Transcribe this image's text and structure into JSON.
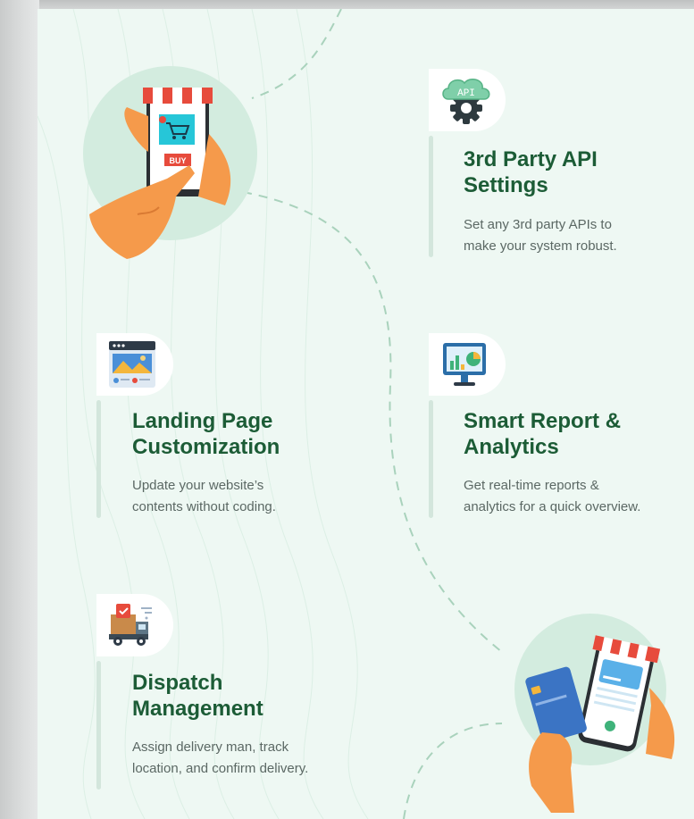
{
  "features": [
    {
      "title_line1": "3rd Party API",
      "title_line2": "Settings",
      "desc_line1": "Set any 3rd party APIs to",
      "desc_line2": "make your system robust.",
      "icon": "api-cloud-gear-icon"
    },
    {
      "title_line1": "Landing Page",
      "title_line2": "Customization",
      "desc_line1": "Update your website’s",
      "desc_line2": "contents without coding.",
      "icon": "webpage-image-icon"
    },
    {
      "title_line1": "Smart Report &",
      "title_line2": "Analytics",
      "desc_line1": "Get real-time reports &",
      "desc_line2": "analytics for a quick overview.",
      "icon": "monitor-chart-icon"
    },
    {
      "title_line1": "Dispatch",
      "title_line2": "Management",
      "desc_line1": "Assign delivery man, track",
      "desc_line2": "location, and confirm delivery.",
      "icon": "delivery-truck-icon"
    }
  ],
  "illustrations": {
    "phone_buy_text": "BUY",
    "api_text": "API"
  },
  "colors": {
    "title": "#1c5c36",
    "desc": "#5b6864",
    "background": "#eef8f3",
    "circle": "#d3ecdf",
    "accent_orange": "#f59a4b",
    "dashed_path": "#a9d2bc"
  }
}
